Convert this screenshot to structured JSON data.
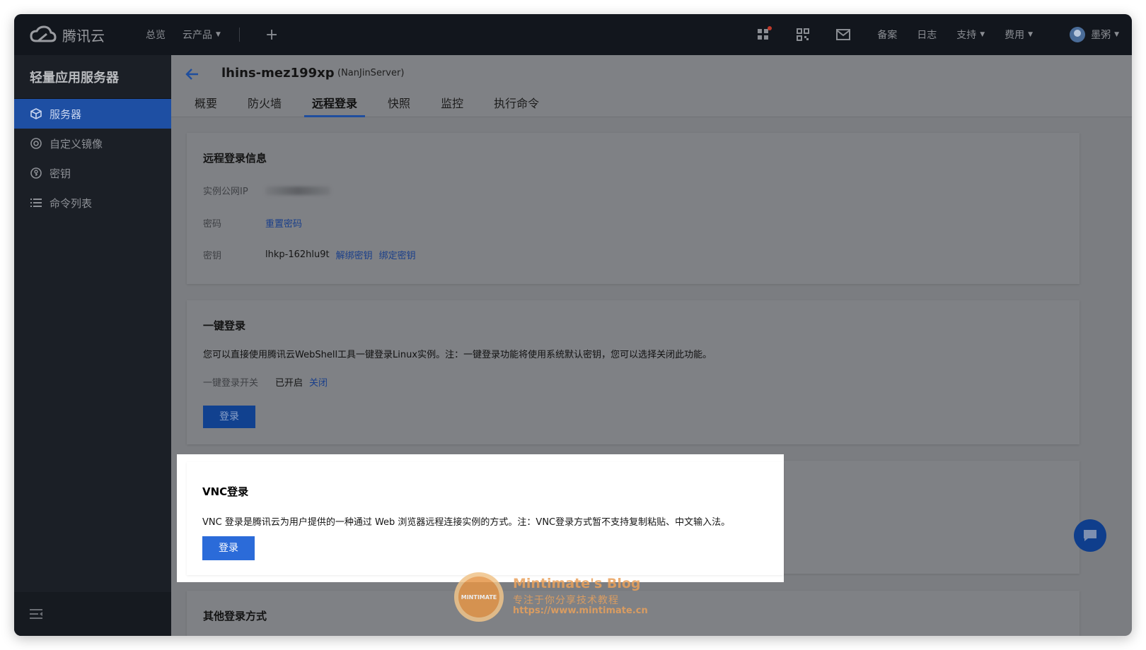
{
  "topbar": {
    "brand": "腾讯云",
    "nav": {
      "overview": "总览",
      "products": "云产品"
    },
    "links": {
      "beian": "备案",
      "log": "日志",
      "support": "支持",
      "billing": "费用"
    },
    "user": "墨粥"
  },
  "sidebar": {
    "title": "轻量应用服务器",
    "items": [
      {
        "label": "服务器",
        "icon": "cube-icon",
        "active": true
      },
      {
        "label": "自定义镜像",
        "icon": "disc-icon",
        "active": false
      },
      {
        "label": "密钥",
        "icon": "key-icon",
        "active": false
      },
      {
        "label": "命令列表",
        "icon": "list-icon",
        "active": false
      }
    ]
  },
  "instance": {
    "name": "lhins-mez199xp",
    "alias": "(NanJinServer)"
  },
  "tabs": [
    {
      "label": "概要",
      "active": false
    },
    {
      "label": "防火墙",
      "active": false
    },
    {
      "label": "远程登录",
      "active": true
    },
    {
      "label": "快照",
      "active": false
    },
    {
      "label": "监控",
      "active": false
    },
    {
      "label": "执行命令",
      "active": false
    }
  ],
  "remote_info": {
    "title": "远程登录信息",
    "public_ip_label": "实例公网IP",
    "password_label": "密码",
    "reset_password": "重置密码",
    "key_label": "密钥",
    "key_value": "lhkp-162hlu9t",
    "unbind_key": "解绑密钥",
    "bind_key": "绑定密钥"
  },
  "one_click": {
    "title": "一键登录",
    "description": "您可以直接使用腾讯云WebShell工具一键登录Linux实例。注：一键登录功能将使用系统默认密钥，您可以选择关闭此功能。",
    "switch_label": "一键登录开关",
    "status": "已开启",
    "close_link": "关闭",
    "login_button": "登录"
  },
  "vnc": {
    "title": "VNC登录",
    "description": "VNC 登录是腾讯云为用户提供的一种通过 Web 浏览器远程连接实例的方式。注：VNC登录方式暂不支持复制粘贴、中文输入法。",
    "login_button": "登录"
  },
  "other": {
    "title": "其他登录方式"
  },
  "watermark": {
    "badge": "MINTIMATE",
    "title": "Mintimate's Blog",
    "slogan": "专注于你分享技术教程",
    "url": "https://www.mintimate.cn"
  },
  "colors": {
    "topbar": "#12161d",
    "sidebar": "#1b1f26",
    "sidebar_active": "#1e4fa3",
    "overlay_bg": "#7b7d81",
    "primary_button": "#2b6bd9",
    "link": "#1a3f8a"
  }
}
